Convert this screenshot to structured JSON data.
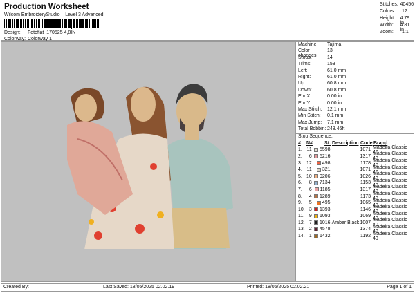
{
  "header": {
    "title": "Production Worksheet",
    "subtitle": "Wilcom EmbroideryStudio – Level 3 Advanced",
    "design_label": "Design:",
    "design_value": "Fotoflat_170525 4,8IN",
    "colorway_label": "Colorway:",
    "colorway_value": "Colorway 1"
  },
  "stats": [
    {
      "label": "Stitches:",
      "value": "40456"
    },
    {
      "label": "Colors:",
      "value": "12"
    },
    {
      "label": "Height:",
      "value": "4.79 in"
    },
    {
      "label": "Width:",
      "value": "4.81 in"
    },
    {
      "label": "Zoom:",
      "value": "1:1"
    }
  ],
  "machine_info": [
    {
      "label": "Machine:",
      "value": "Tajima"
    },
    {
      "label": "Color changes:",
      "value": "13"
    },
    {
      "label": "Stops:",
      "value": "14"
    },
    {
      "label": "Trims:",
      "value": "153"
    },
    {
      "label": "Left:",
      "value": "61.0 mm"
    },
    {
      "label": "Right:",
      "value": "61.0 mm"
    },
    {
      "label": "Up:",
      "value": "60.8 mm"
    },
    {
      "label": "Down:",
      "value": "60.8 mm"
    },
    {
      "label": "EndX:",
      "value": "0.00 in"
    },
    {
      "label": "EndY:",
      "value": "0.00 in"
    },
    {
      "label": "Max Stitch:",
      "value": "12.1 mm"
    },
    {
      "label": "Min Stitch:",
      "value": "0.1 mm"
    },
    {
      "label": "Max Jump:",
      "value": "7.1 mm"
    },
    {
      "label": "Total Bobbin:",
      "value": "248.46ft"
    }
  ],
  "stop_sequence": {
    "title": "Stop Sequence:",
    "headers": [
      "#",
      "N#",
      "St.",
      "Description",
      "Code",
      "Brand"
    ],
    "rows": [
      {
        "n": "1.",
        "id": "11",
        "color": "#e6e0d4",
        "st": "5598",
        "desc": "",
        "code": "1071",
        "brand": "Madeira Classic 40"
      },
      {
        "n": "2.",
        "id": "6",
        "color": "#e89a9c",
        "st": "5216",
        "desc": "",
        "code": "1317",
        "brand": "Madeira Classic 40"
      },
      {
        "n": "3.",
        "id": "12",
        "color": "#f06444",
        "st": "498",
        "desc": "",
        "code": "1178",
        "brand": "Madeira Classic 40"
      },
      {
        "n": "4.",
        "id": "11",
        "color": "#ddd8cc",
        "st": "321",
        "desc": "",
        "code": "1071",
        "brand": "Madeira Classic 40"
      },
      {
        "n": "5.",
        "id": "10",
        "color": "#f2b080",
        "st": "9206",
        "desc": "",
        "code": "1026",
        "brand": "Madeira Classic 40"
      },
      {
        "n": "6.",
        "id": "8",
        "color": "#94b2d0",
        "st": "7134",
        "desc": "",
        "code": "1153",
        "brand": "Madeira Classic 40"
      },
      {
        "n": "7.",
        "id": "6",
        "color": "#eaa2a2",
        "st": "1185",
        "desc": "",
        "code": "1317",
        "brand": "Madeira Classic 40"
      },
      {
        "n": "8.",
        "id": "4",
        "color": "#b87444",
        "st": "1289",
        "desc": "",
        "code": "1173",
        "brand": "Madeira Classic 40"
      },
      {
        "n": "9.",
        "id": "5",
        "color": "#ea7424",
        "st": "495",
        "desc": "",
        "code": "1065",
        "brand": "Madeira Classic 40"
      },
      {
        "n": "10.",
        "id": "3",
        "color": "#d02020",
        "st": "1393",
        "desc": "",
        "code": "1146",
        "brand": "Madeira Classic 40"
      },
      {
        "n": "11.",
        "id": "9",
        "color": "#f2b010",
        "st": "1093",
        "desc": "",
        "code": "1069",
        "brand": "Madeira Classic 40"
      },
      {
        "n": "12.",
        "id": "7",
        "color": "#202020",
        "st": "1016",
        "desc": "Amber Black",
        "code": "1007",
        "brand": "Madeira Classic 40"
      },
      {
        "n": "13.",
        "id": "2",
        "color": "#602434",
        "st": "4578",
        "desc": "",
        "code": "1374",
        "brand": "Madeira Classic 40"
      },
      {
        "n": "14.",
        "id": "1",
        "color": "#a26a22",
        "st": "1432",
        "desc": "",
        "code": "1192",
        "brand": "Madeira Classic 40"
      }
    ]
  },
  "footer": {
    "created_by": "Created By:",
    "last_saved": "Last Saved: 18/05/2025 02.02.19",
    "printed": "Printed: 18/05/2025 02.02.21",
    "page": "Page 1 of 1"
  }
}
